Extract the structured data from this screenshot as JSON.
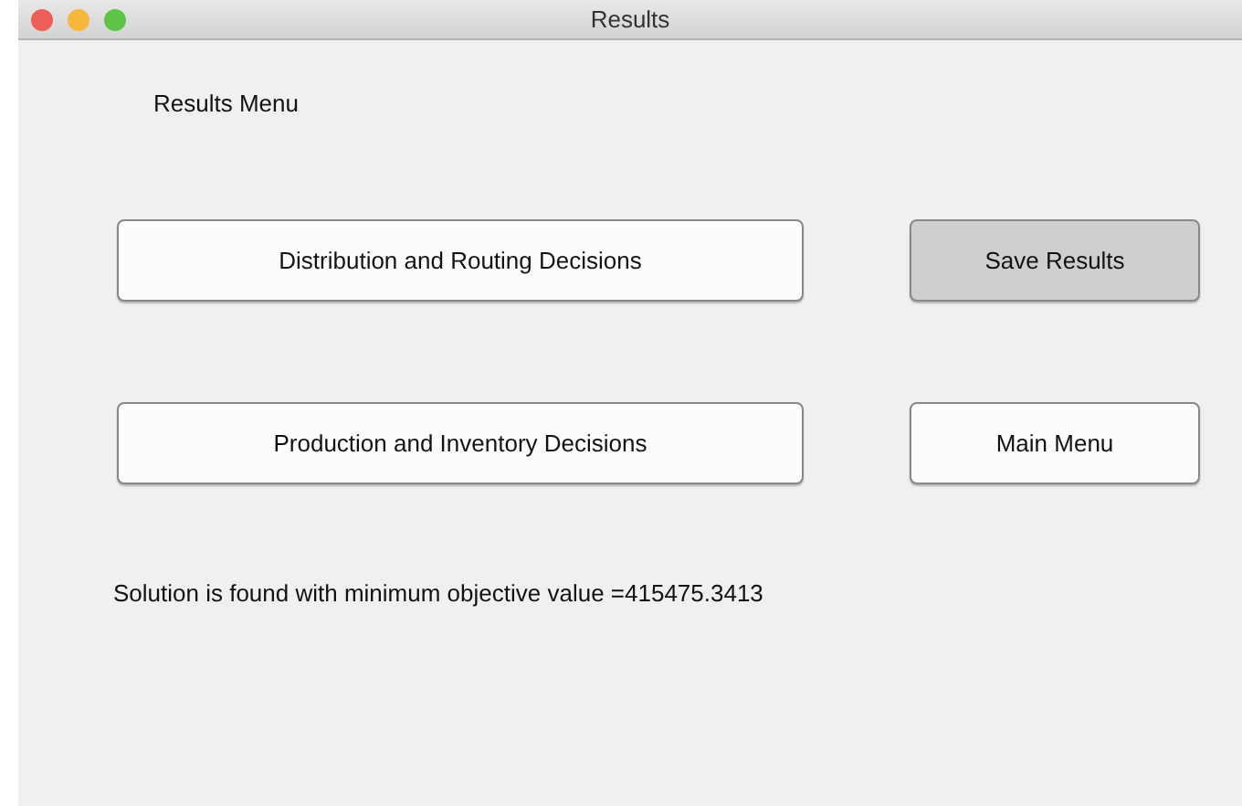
{
  "window": {
    "title": "Results"
  },
  "heading": "Results Menu",
  "buttons": [
    {
      "label": "Distribution and Routing Decisions",
      "highlighted": false
    },
    {
      "label": "Save Results",
      "highlighted": true
    },
    {
      "label": "Production and Inventory Decisions",
      "highlighted": false
    },
    {
      "label": "Main Menu",
      "highlighted": false
    }
  ],
  "message": "Solution is found with minimum objective value =415475.3413"
}
